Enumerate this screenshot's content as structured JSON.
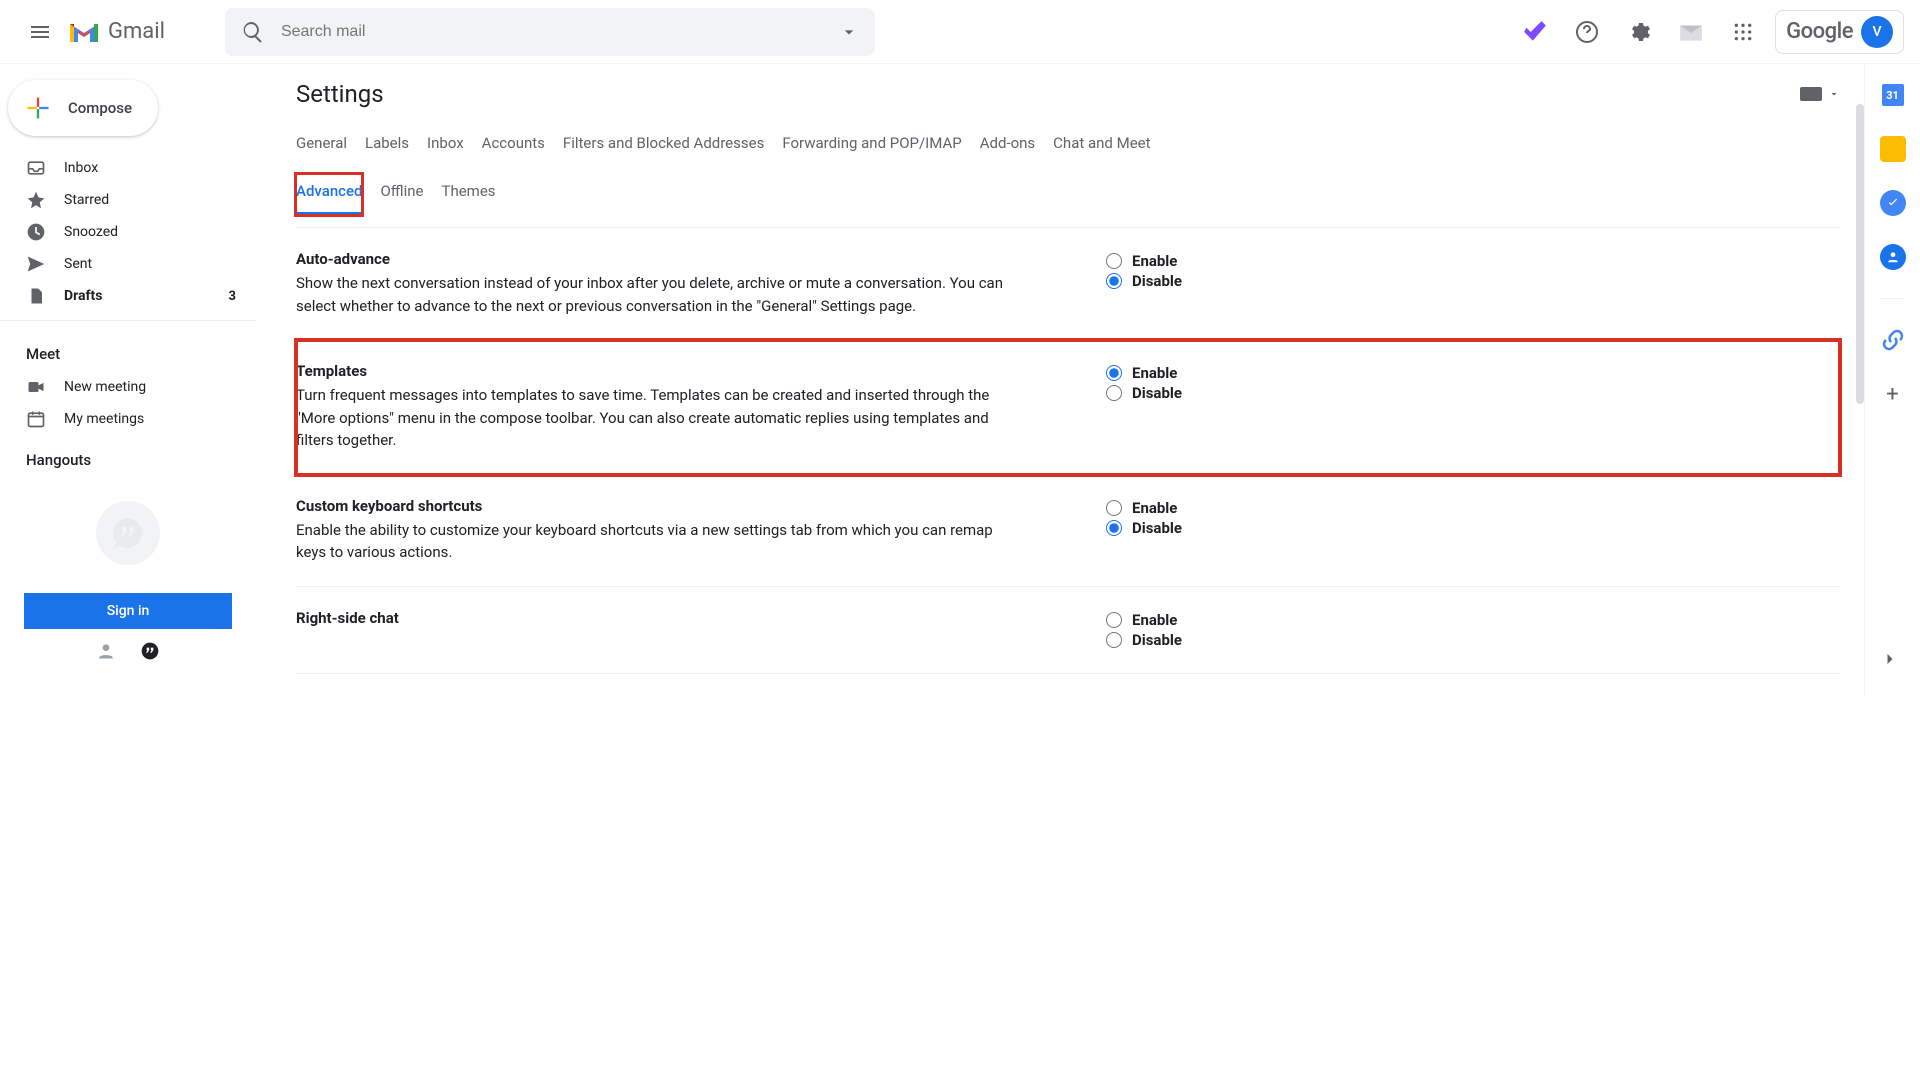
{
  "header": {
    "app_name": "Gmail",
    "search_placeholder": "Search mail",
    "google_label": "Google",
    "avatar_initial": "V"
  },
  "compose_label": "Compose",
  "nav": [
    {
      "icon": "inbox",
      "label": "Inbox",
      "bold": false,
      "count": ""
    },
    {
      "icon": "star",
      "label": "Starred",
      "bold": false,
      "count": ""
    },
    {
      "icon": "clock",
      "label": "Snoozed",
      "bold": false,
      "count": ""
    },
    {
      "icon": "send",
      "label": "Sent",
      "bold": false,
      "count": ""
    },
    {
      "icon": "file",
      "label": "Drafts",
      "bold": true,
      "count": "3"
    }
  ],
  "meet": {
    "label": "Meet",
    "items": [
      {
        "icon": "video",
        "label": "New meeting"
      },
      {
        "icon": "cal",
        "label": "My meetings"
      }
    ]
  },
  "hangouts_label": "Hangouts",
  "signin_label": "Sign in",
  "page_title": "Settings",
  "tabs_row1": [
    "General",
    "Labels",
    "Inbox",
    "Accounts",
    "Filters and Blocked Addresses",
    "Forwarding and POP/IMAP",
    "Add-ons",
    "Chat and Meet"
  ],
  "tabs_row2": [
    "Advanced",
    "Offline",
    "Themes"
  ],
  "active_tab": "Advanced",
  "enable_label": "Enable",
  "disable_label": "Disable",
  "settings": [
    {
      "title": "Auto-advance",
      "desc": "Show the next conversation instead of your inbox after you delete, archive or mute a conversation. You can select whether to advance to the next or previous conversation in the \"General\" Settings page.",
      "selected": "disable",
      "highlight": false
    },
    {
      "title": "Templates",
      "desc": "Turn frequent messages into templates to save time. Templates can be created and inserted through the \"More options\" menu in the compose toolbar. You can also create automatic replies using templates and filters together.",
      "selected": "enable",
      "highlight": true
    },
    {
      "title": "Custom keyboard shortcuts",
      "desc": "Enable the ability to customize your keyboard shortcuts via a new settings tab from which you can remap keys to various actions.",
      "selected": "disable",
      "highlight": false
    },
    {
      "title": "Right-side chat",
      "desc": "",
      "selected": "",
      "highlight": false
    }
  ]
}
